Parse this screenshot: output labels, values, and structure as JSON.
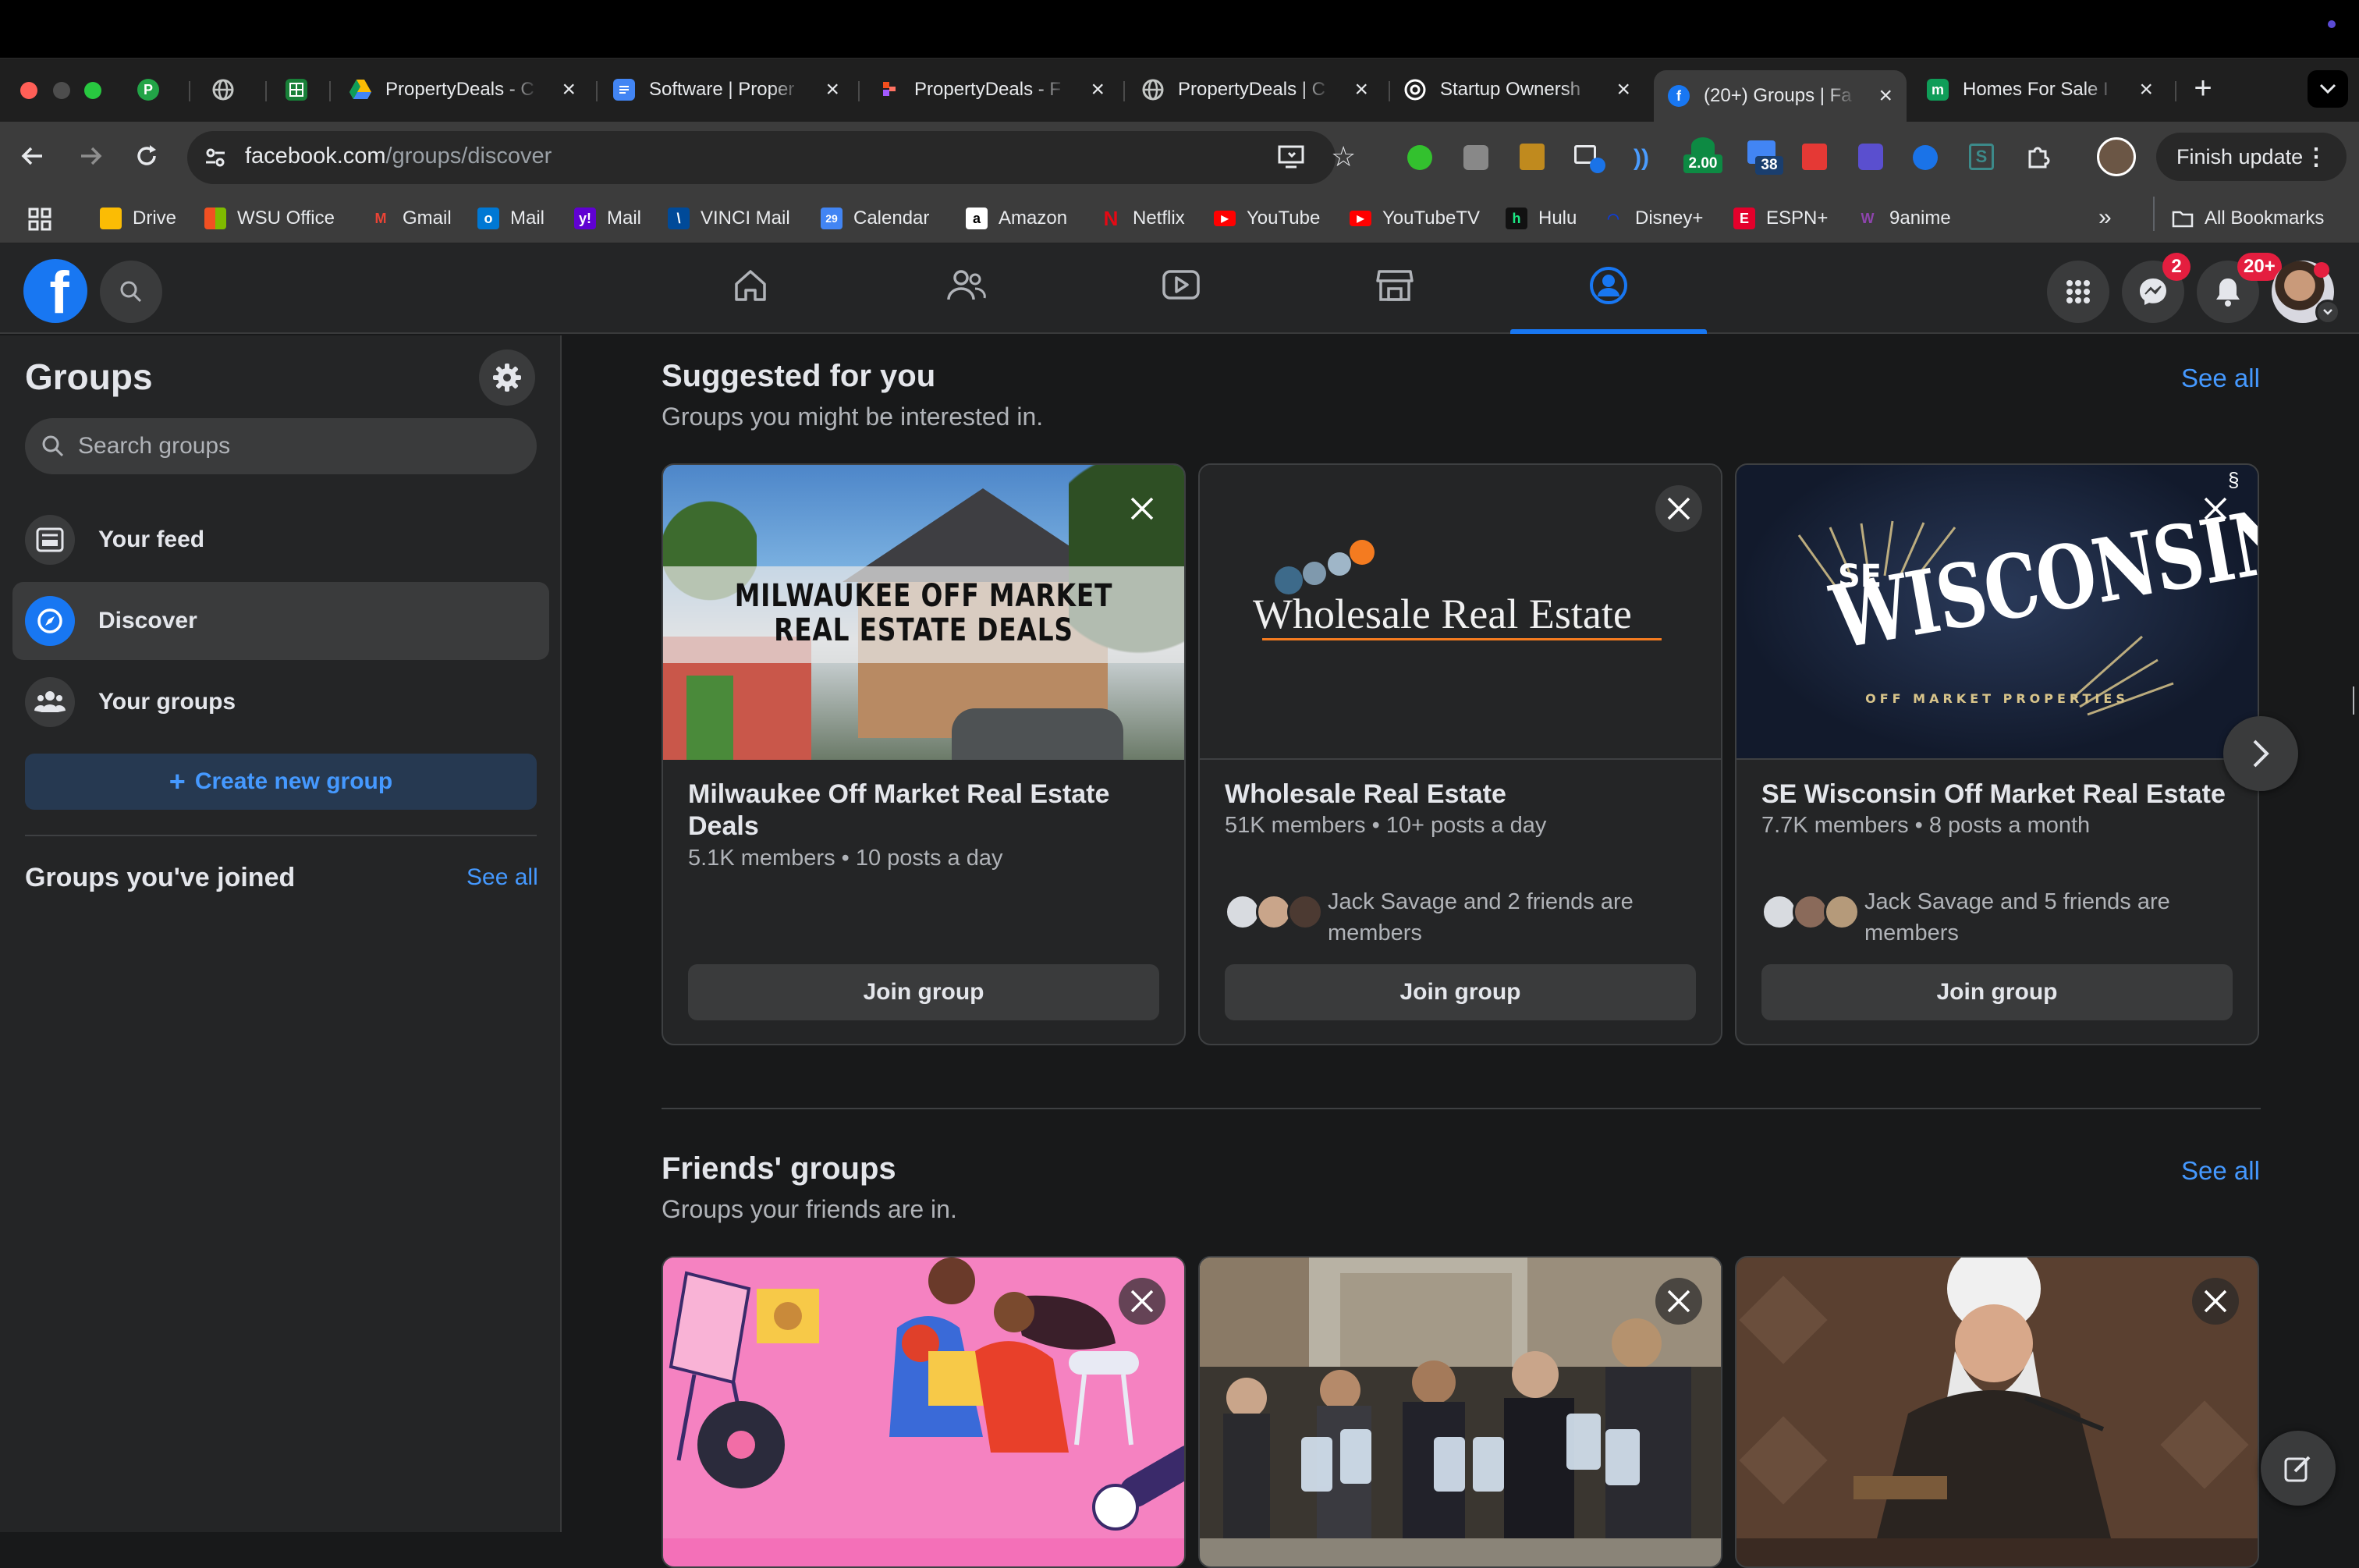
{
  "browser": {
    "tabs": [
      {
        "title": "",
        "favicon": "P",
        "color": "#22a447"
      },
      {
        "title": "",
        "favicon": "globe",
        "color": "#5f6368"
      },
      {
        "title": "",
        "favicon": "sheets",
        "color": "#188038"
      },
      {
        "title": "PropertyDeals - C",
        "favicon": "drive",
        "color": "#fbbc04"
      },
      {
        "title": "Software | Proper",
        "favicon": "docs",
        "color": "#4285f4"
      },
      {
        "title": "PropertyDeals - F",
        "favicon": "figma",
        "color": "#f24e1e"
      },
      {
        "title": "PropertyDeals | C",
        "favicon": "globe",
        "color": "#5f6368"
      },
      {
        "title": "Startup Ownersh",
        "favicon": "openai",
        "color": "#ffffff"
      },
      {
        "title": "(20+) Groups | Fa",
        "favicon": "facebook",
        "color": "#1877f2"
      },
      {
        "title": "Homes For Sale I",
        "favicon": "m",
        "color": "#0f9d58"
      }
    ],
    "url_domain": "facebook.com",
    "url_path": "/groups/discover",
    "finish_update": "Finish update",
    "extension_badge_1": "2.00",
    "extension_badge_2": "38",
    "bookmarks": [
      {
        "label": "Drive",
        "color": "#fbbc04"
      },
      {
        "label": "WSU Office",
        "color": "#f25022"
      },
      {
        "label": "Gmail",
        "color": "#ea4335"
      },
      {
        "label": "Mail",
        "color": "#0078d4"
      },
      {
        "label": "Mail",
        "color": "#6001d2"
      },
      {
        "label": "VINCI Mail",
        "color": "#004a99"
      },
      {
        "label": "Calendar",
        "color": "#4285f4"
      },
      {
        "label": "Amazon",
        "color": "#ffffff"
      },
      {
        "label": "Netflix",
        "color": "#e50914"
      },
      {
        "label": "YouTube",
        "color": "#ff0000"
      },
      {
        "label": "YouTubeTV",
        "color": "#ff0000"
      },
      {
        "label": "Hulu",
        "color": "#1ce783"
      },
      {
        "label": "Disney+",
        "color": "#113ccf"
      },
      {
        "label": "ESPN+",
        "color": "#e4002b"
      },
      {
        "label": "9anime",
        "color": "#8e44ad"
      }
    ],
    "all_bookmarks": "All Bookmarks"
  },
  "fb": {
    "messenger_badge": "2",
    "notif_badge": "20+"
  },
  "sidebar": {
    "title": "Groups",
    "search_placeholder": "Search groups",
    "items": [
      {
        "label": "Your feed"
      },
      {
        "label": "Discover"
      },
      {
        "label": "Your groups"
      }
    ],
    "create_label": "Create new group",
    "joined_title": "Groups you've joined",
    "joined_see_all": "See all"
  },
  "suggested": {
    "title": "Suggested for you",
    "subtitle": "Groups you might be interested in.",
    "see_all": "See all",
    "cards": [
      {
        "name": "Milwaukee Off Market Real Estate Deals",
        "meta": "5.1K members • 10 posts a day",
        "image_text_1": "MILWAUKEE OFF MARKET",
        "image_text_2": "REAL ESTATE DEALS",
        "friends": "",
        "join": "Join group"
      },
      {
        "name": "Wholesale Real Estate",
        "meta": "51K members • 10+ posts a day",
        "image_text_1": "Wholesale Real Estate",
        "friends": "Jack Savage and 2 friends are members",
        "join": "Join group"
      },
      {
        "name": "SE Wisconsin Off Market Real Estate",
        "meta": "7.7K members • 8 posts a month",
        "image_text_1": "SE",
        "image_text_2": "WISCONSIN",
        "image_text_3": "OFF MARKET PROPERTIES",
        "friends": "Jack Savage and 5 friends are members",
        "join": "Join group"
      }
    ]
  },
  "friends_groups": {
    "title": "Friends' groups",
    "subtitle": "Groups your friends are in.",
    "see_all": "See all"
  }
}
